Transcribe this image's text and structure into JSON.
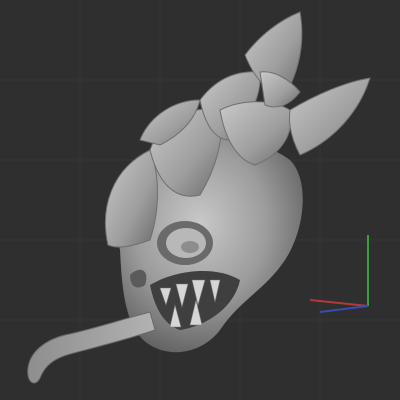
{
  "viewport": {
    "background": "#2f2f2f",
    "grid_color": "#353535"
  },
  "model": {
    "name": "creature-head-sculpt",
    "material_color": "#9a9a9a"
  },
  "axis_gizmo": {
    "x_color": "#b23a3a",
    "y_color": "#3aa03a",
    "z_color": "#3a4ab2"
  }
}
